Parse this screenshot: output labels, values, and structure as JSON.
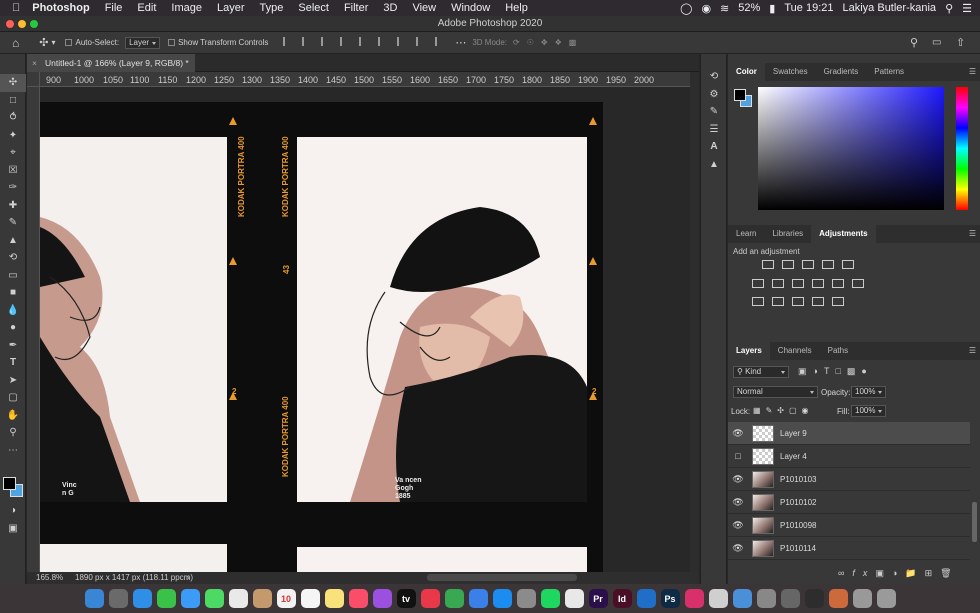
{
  "menubar": {
    "app_name": "Photoshop",
    "items": [
      "File",
      "Edit",
      "Image",
      "Layer",
      "Type",
      "Select",
      "Filter",
      "3D",
      "View",
      "Window",
      "Help"
    ],
    "battery": "52%",
    "clock": "Tue 19:21",
    "user": "Lakiya Butler-kania"
  },
  "window": {
    "title": "Adobe Photoshop 2020"
  },
  "options_bar": {
    "auto_select_label": "Auto-Select:",
    "auto_select_value": "Layer",
    "show_transform_label": "Show Transform Controls",
    "three_d_mode_label": "3D Mode:"
  },
  "document": {
    "tab_label": "Untitled-1 @ 166% (Layer 9, RGB/8) *",
    "ruler_ticks": [
      "900",
      "1000",
      "1050",
      "1100",
      "1150",
      "1200",
      "1250",
      "1300",
      "1350",
      "1400",
      "1450",
      "1500",
      "1550",
      "1600",
      "1650",
      "1700",
      "1750",
      "1800",
      "1850",
      "1900",
      "1950",
      "2000"
    ],
    "film_text": [
      "KODAK PORTRA 400",
      "43",
      "KODAK PORTRA 400",
      "2",
      "KODAK PORTRA 400",
      "2"
    ],
    "hoodie_text": [
      "Va",
      "ncen",
      "Gogh",
      "1885",
      "Vinc",
      "n G"
    ]
  },
  "status": {
    "zoom": "165.8%",
    "doc_size": "1890 px x 1417 px (118.11 ppcm)"
  },
  "color_panel": {
    "tabs": [
      "Color",
      "Swatches",
      "Gradients",
      "Patterns"
    ],
    "active_tab": "Color",
    "foreground": "#000000",
    "background": "#4fa3e0"
  },
  "adjustments_panel": {
    "tabs": [
      "Learn",
      "Libraries",
      "Adjustments"
    ],
    "active_tab": "Adjustments",
    "hint": "Add an adjustment"
  },
  "layers_panel": {
    "tabs": [
      "Layers",
      "Channels",
      "Paths"
    ],
    "active_tab": "Layers",
    "filter_label": "Kind",
    "blend_mode": "Normal",
    "opacity_label": "Opacity:",
    "opacity_value": "100%",
    "lock_label": "Lock:",
    "fill_label": "Fill:",
    "fill_value": "100%",
    "layers": [
      {
        "name": "Layer 9",
        "visible": true,
        "selected": true,
        "photo": false
      },
      {
        "name": "Layer 4",
        "visible": false,
        "selected": false,
        "photo": false
      },
      {
        "name": "P1010103",
        "visible": true,
        "selected": false,
        "photo": true
      },
      {
        "name": "P1010102",
        "visible": true,
        "selected": false,
        "photo": true
      },
      {
        "name": "P1010098",
        "visible": true,
        "selected": false,
        "photo": true
      },
      {
        "name": "P1010114",
        "visible": true,
        "selected": false,
        "photo": true
      }
    ]
  },
  "dock": {
    "apps": [
      {
        "label": "",
        "color": "#3a86d6",
        "icon": "finder-icon"
      },
      {
        "label": "",
        "color": "#6a6a6a",
        "icon": "launchpad-icon"
      },
      {
        "label": "",
        "color": "#2f8ee6",
        "icon": "safari-icon"
      },
      {
        "label": "",
        "color": "#3ac14a",
        "icon": "facetime-icon"
      },
      {
        "label": "",
        "color": "#3b9bf7",
        "icon": "mail-icon"
      },
      {
        "label": "",
        "color": "#4cd964",
        "icon": "messages-icon"
      },
      {
        "label": "",
        "color": "#e9e9e9",
        "icon": "photos-icon"
      },
      {
        "label": "",
        "color": "#c49a6c",
        "icon": "contacts-icon"
      },
      {
        "label": "10",
        "color": "#f2f2f2",
        "icon": "calendar-icon"
      },
      {
        "label": "",
        "color": "#f5f5f5",
        "icon": "reminders-icon"
      },
      {
        "label": "",
        "color": "#f9e27a",
        "icon": "notes-icon"
      },
      {
        "label": "",
        "color": "#fa4d6a",
        "icon": "music-icon"
      },
      {
        "label": "",
        "color": "#9b50e0",
        "icon": "podcasts-icon"
      },
      {
        "label": "tv",
        "color": "#111111",
        "icon": "tv-icon"
      },
      {
        "label": "",
        "color": "#e8384a",
        "icon": "news-icon"
      },
      {
        "label": "",
        "color": "#39a852",
        "icon": "numbers-icon"
      },
      {
        "label": "",
        "color": "#3b7fe8",
        "icon": "keynote-icon"
      },
      {
        "label": "",
        "color": "#1b8cf0",
        "icon": "appstore-icon"
      },
      {
        "label": "",
        "color": "#8b8b8b",
        "icon": "preferences-icon"
      },
      {
        "label": "",
        "color": "#1ed760",
        "icon": "spotify-icon"
      },
      {
        "label": "",
        "color": "#e8e8e8",
        "icon": "finder-window-icon"
      },
      {
        "label": "Pr",
        "color": "#2a0f4a",
        "icon": "premiere-icon"
      },
      {
        "label": "Id",
        "color": "#4a0f27",
        "icon": "indesign-icon"
      },
      {
        "label": "",
        "color": "#1f6fc9",
        "icon": "globe-icon"
      },
      {
        "label": "Ps",
        "color": "#0f2a44",
        "icon": "photoshop-icon"
      },
      {
        "label": "",
        "color": "#d8306a",
        "icon": "creative-cloud-icon"
      },
      {
        "label": "",
        "color": "#cfcfcf",
        "icon": "document-icon"
      },
      {
        "label": "",
        "color": "#4a90d9",
        "icon": "folder-icon"
      },
      {
        "label": "",
        "color": "#888888",
        "icon": "image-icon"
      },
      {
        "label": "",
        "color": "#666666",
        "icon": "image-icon-2"
      },
      {
        "label": "",
        "color": "#2d2d2d",
        "icon": "window-icon"
      },
      {
        "label": "",
        "color": "#cc6a3c",
        "icon": "photo-icon"
      },
      {
        "label": "",
        "color": "#999999",
        "icon": "download-icon"
      },
      {
        "label": "",
        "color": "#9a9a9a",
        "icon": "trash-icon"
      }
    ]
  }
}
